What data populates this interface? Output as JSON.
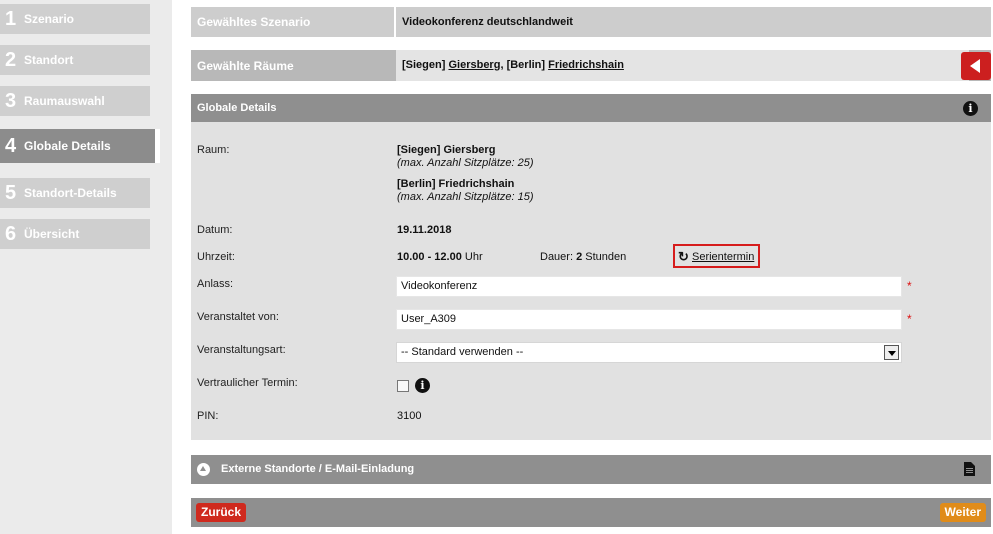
{
  "sidebar": {
    "steps": [
      {
        "num": "1",
        "label": "Szenario"
      },
      {
        "num": "2",
        "label": "Standort"
      },
      {
        "num": "3",
        "label": "Raumauswahl"
      },
      {
        "num": "4",
        "label": "Globale Details"
      },
      {
        "num": "5",
        "label": "Standort-Details"
      },
      {
        "num": "6",
        "label": "Übersicht"
      }
    ],
    "active_step": "4"
  },
  "selected_scenario": {
    "label": "Gewähltes Szenario",
    "value": "Videokonferenz deutschlandweit"
  },
  "selected_rooms": {
    "label": "Gewählte Räume",
    "rooms": [
      {
        "prefix": "[Siegen]",
        "name": "Giersberg"
      },
      {
        "prefix": "[Berlin]",
        "name": "Friedrichshain"
      }
    ],
    "separator": ","
  },
  "global_details": {
    "title": "Globale Details",
    "room_label": "Raum:",
    "rooms": [
      {
        "name": "[Siegen] Giersberg",
        "capacity": "(max. Anzahl Sitzplätze: 25)"
      },
      {
        "name": "[Berlin] Friedrichshain",
        "capacity": "(max. Anzahl Sitzplätze: 15)"
      }
    ],
    "date_label": "Datum:",
    "date": "19.11.2018",
    "time_label": "Uhrzeit:",
    "time_bold": "10.00 - 12.00",
    "time_unit": "Uhr",
    "duration_label": "Dauer:",
    "duration_bold": "2",
    "duration_unit": "Stunden",
    "series_link": "Serientermin",
    "occasion_label": "Anlass:",
    "occasion_value": "Videokonferenz",
    "organizer_label": "Veranstaltet von:",
    "organizer_value": "User_A309",
    "required_mark": "*",
    "event_type_label": "Veranstaltungsart:",
    "event_type_value": "-- Standard verwenden --",
    "confidential_label": "Vertraulicher Termin:",
    "confidential_checked": false,
    "pin_label": "PIN:",
    "pin_value": "3100"
  },
  "external": {
    "title": "Externe Standorte / E-Mail-Einladung"
  },
  "footer": {
    "back_label": "Zurück",
    "next_label": "Weiter"
  },
  "colors": {
    "back_button": "#cf2a1e",
    "next_button": "#e08c1a",
    "highlight_border": "#d61c1c",
    "header_gray": "#8f8f8f"
  }
}
